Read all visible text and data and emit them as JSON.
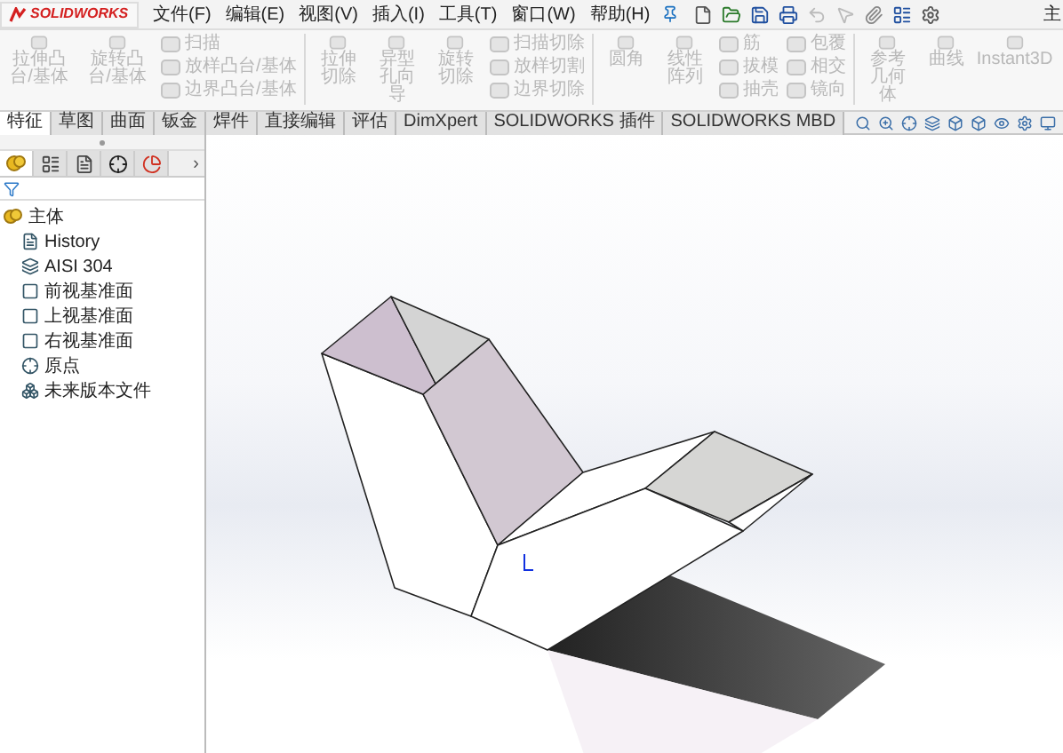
{
  "app": {
    "logo": "SOLIDWORKS",
    "menu": [
      "文件(F)",
      "编辑(E)",
      "视图(V)",
      "插入(I)",
      "工具(T)",
      "窗口(W)",
      "帮助(H)"
    ],
    "title_cut": "主"
  },
  "ribbon": {
    "groups": [
      {
        "kind": "large",
        "label": "拉伸凸台/基体",
        "disabled": true
      },
      {
        "kind": "large",
        "label": "旋转凸台/基体",
        "disabled": true
      },
      {
        "kind": "small",
        "items": [
          {
            "label": "扫描",
            "disabled": true
          },
          {
            "label": "放样凸台/基体",
            "disabled": true
          },
          {
            "label": "边界凸台/基体",
            "disabled": true
          }
        ]
      },
      {
        "kind": "separator"
      },
      {
        "kind": "large",
        "label": "拉伸切除",
        "disabled": true
      },
      {
        "kind": "large",
        "label": "异型孔向导",
        "disabled": true
      },
      {
        "kind": "large",
        "label": "旋转切除",
        "disabled": true
      },
      {
        "kind": "small",
        "items": [
          {
            "label": "扫描切除",
            "disabled": true
          },
          {
            "label": "放样切割",
            "disabled": true
          },
          {
            "label": "边界切除",
            "disabled": true
          }
        ]
      },
      {
        "kind": "separator"
      },
      {
        "kind": "large",
        "label": "圆角",
        "disabled": true
      },
      {
        "kind": "large",
        "label": "线性阵列",
        "disabled": true
      },
      {
        "kind": "small",
        "items": [
          {
            "label": "筋",
            "disabled": true
          },
          {
            "label": "拔模",
            "disabled": true
          },
          {
            "label": "抽壳",
            "disabled": true
          }
        ]
      },
      {
        "kind": "small",
        "items": [
          {
            "label": "包覆",
            "disabled": true
          },
          {
            "label": "相交",
            "disabled": true
          },
          {
            "label": "镜向",
            "disabled": true
          }
        ]
      },
      {
        "kind": "separator"
      },
      {
        "kind": "large",
        "label": "参考几何体",
        "disabled": true
      },
      {
        "kind": "large",
        "label": "曲线",
        "disabled": true
      },
      {
        "kind": "large",
        "label": "Instant3D",
        "disabled": true
      }
    ]
  },
  "tabs": [
    {
      "label": "特征",
      "selected": true
    },
    {
      "label": "草图",
      "selected": false
    },
    {
      "label": "曲面",
      "selected": false
    },
    {
      "label": "钣金",
      "selected": false
    },
    {
      "label": "焊件",
      "selected": false
    },
    {
      "label": "直接编辑",
      "selected": false
    },
    {
      "label": "评估",
      "selected": false
    },
    {
      "label": "DimXpert",
      "selected": false
    },
    {
      "label": "SOLIDWORKS 插件",
      "selected": false
    },
    {
      "label": "SOLIDWORKS MBD",
      "selected": false
    }
  ],
  "panel": {
    "tabs": [
      {
        "kind": "feature",
        "selected": true
      },
      {
        "kind": "property",
        "selected": false
      },
      {
        "kind": "config",
        "selected": false
      },
      {
        "kind": "dim",
        "selected": false
      },
      {
        "kind": "display",
        "selected": false
      }
    ],
    "more": "›",
    "tree": [
      {
        "label": "主体",
        "kind": "part",
        "children": [
          {
            "label": "History",
            "kind": "history"
          },
          {
            "label": "AISI 304",
            "kind": "material"
          },
          {
            "label": "前视基准面",
            "kind": "plane"
          },
          {
            "label": "上视基准面",
            "kind": "plane"
          },
          {
            "label": "右视基准面",
            "kind": "plane"
          },
          {
            "label": "原点",
            "kind": "origin"
          },
          {
            "label": "未来版本文件",
            "kind": "future"
          }
        ]
      }
    ]
  }
}
